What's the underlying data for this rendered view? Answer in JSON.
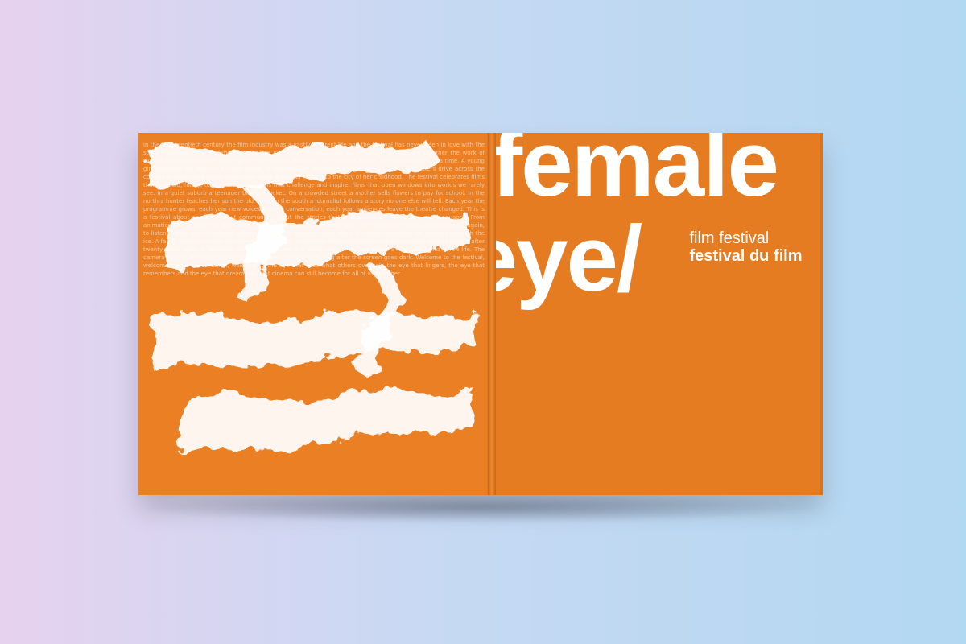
{
  "cover": {
    "title_line1": "female",
    "title_line2": "eye/",
    "subtitle_en": "film festival",
    "subtitle_fr": "festival du film"
  },
  "back": {
    "fine_print": "in the late twentieth century the film industry was a vastly different life and the festival has never been in love with the story of female directors who came before us. Since the beginning the program has brought together the work of women from every corner of the globe, one feature at a time, one short at a time, one documentary at a time. A young girl discovers her voice in a small village. A grandmother recounts the war she survived. Two sisters drive across the country in search of a father they never knew. A painter returns to the city of her childhood. The festival celebrates films that are bold, funny, tender and fierce, films that challenge and inspire, films that open windows into worlds we rarely see. In a quiet suburb a teenager builds a rocket. On a crowded street a mother sells flowers to pay for school. In the north a hunter teaches her son the old ways. In the south a journalist follows a story no one else will tell. Each year the programme grows, each year new voices join the conversation, each year audiences leave the theatre changed. This is a festival about courage, about community, about the stories that connect us across borders and languages. From animation to experimental work, from intimate portraits to sweeping epics, the selection invites viewers to look again, to listen closely and to imagine differently. A dancer recovers from injury. A scientist searches for answers beneath the ice. A family gathers for one last summer at the lake. A musician finds her rhythm in a new country. Friends reunite after twenty years apart. A detective unravels a mystery in a small town. A refugee builds a new home and a new life. The camera follows, the audience watches, and the stories remain long after the screen goes dark. Welcome to the festival, welcome to the conversation, welcome to the eye that sees what others overlook, the eye that lingers, the eye that remembers and the eye that dreams of what cinema can still become for all of us together."
  },
  "colors": {
    "accent": "#e67c22",
    "text": "#ffffff",
    "background_left": "#e6d2ef",
    "background_right": "#b3d8f2"
  }
}
